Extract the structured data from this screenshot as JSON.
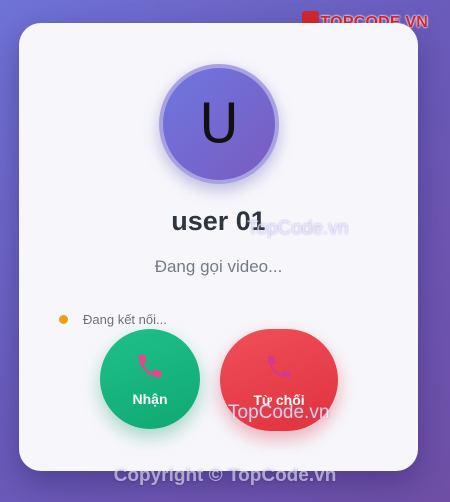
{
  "caller": {
    "initial": "U",
    "name": "user 01",
    "status": "Đang gọi video..."
  },
  "connection": {
    "label": "Đang kết nối...",
    "indicator_color": "#f39c12"
  },
  "actions": {
    "accept_label": "Nhận",
    "accept_color": "#14b07c",
    "accept_icon": "phone-icon",
    "reject_label": "Từ chối",
    "reject_color": "#e63a45",
    "reject_icon": "phone-icon"
  },
  "branding": {
    "logo_text": "TOPCODE.VN",
    "watermark": "TopCode.vn",
    "copyright": "Copyright © TopCode.vn"
  }
}
